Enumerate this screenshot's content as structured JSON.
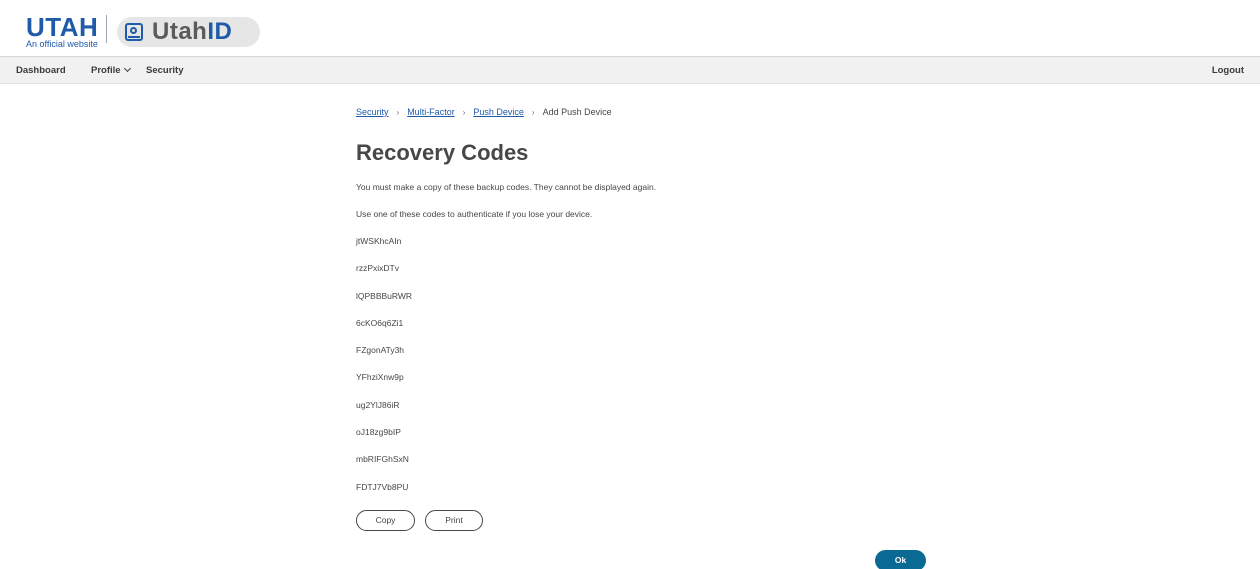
{
  "header": {
    "state_logo": "UTAH",
    "state_sub": "An official website",
    "app_name_prefix": "Utah",
    "app_name_suffix": "ID"
  },
  "nav": {
    "dashboard": "Dashboard",
    "profile": "Profile",
    "security": "Security",
    "logout": "Logout"
  },
  "breadcrumb": {
    "items": [
      "Security",
      "Multi-Factor",
      "Push Device"
    ],
    "separator": "›",
    "current": "Add Push Device"
  },
  "page": {
    "title": "Recovery Codes",
    "para1": "You must make a copy of these backup codes. They cannot be displayed again.",
    "para2": "Use one of these codes to authenticate if you lose your device."
  },
  "codes": [
    "jtWSKhcAIn",
    "rzzPxixDTv",
    "lQPBBBuRWR",
    "6cKO6q6Zi1",
    "FZgonATy3h",
    "YFhziXnw9p",
    "ug2YlJ86iR",
    "oJ18zg9bIP",
    "mbRIFGhSxN",
    "FDTJ7Vb8PU"
  ],
  "buttons": {
    "copy": "Copy",
    "print": "Print",
    "ok": "Ok"
  },
  "colors": {
    "brand_blue": "#1f5ba8",
    "primary_button": "#0b6a94",
    "text": "#474747",
    "nav_bg": "#f1f1f1"
  }
}
